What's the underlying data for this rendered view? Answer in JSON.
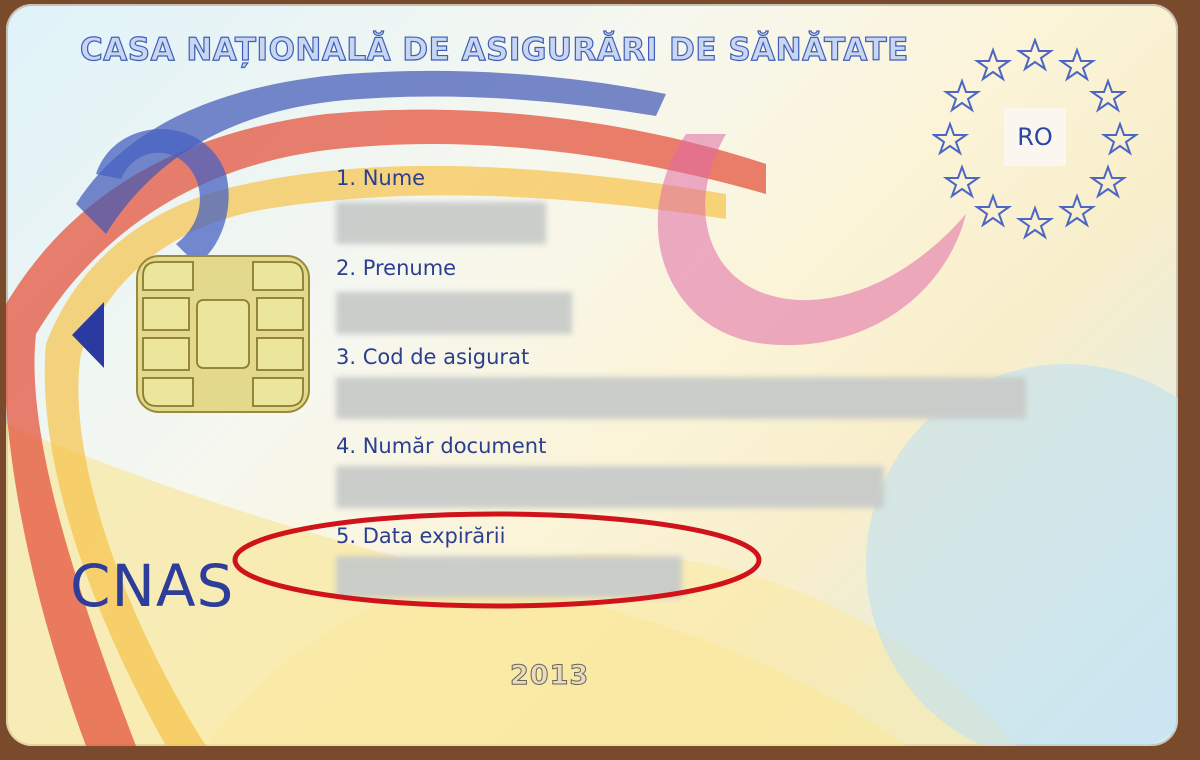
{
  "card": {
    "title": "CASA NAȚIONALĂ DE ASIGURĂRI DE SĂNĂTATE",
    "country_code": "RO",
    "brand": "CNAS",
    "year_mark": "2013"
  },
  "fields": [
    {
      "label": "1. Nume"
    },
    {
      "label": "2. Prenume"
    },
    {
      "label": "3. Cod de asigurat"
    },
    {
      "label": "4. Număr document"
    },
    {
      "label": "5. Data expirării"
    }
  ],
  "icons": [
    "chip-icon",
    "eu-stars-icon",
    "arrow-left-icon"
  ],
  "colors": {
    "text_blue": "#2b3f8e",
    "highlight_red": "#d0131b",
    "ribbon_red": "#e0453a",
    "ribbon_blue": "#3b56b4",
    "ribbon_yellow": "#f6d64a"
  }
}
